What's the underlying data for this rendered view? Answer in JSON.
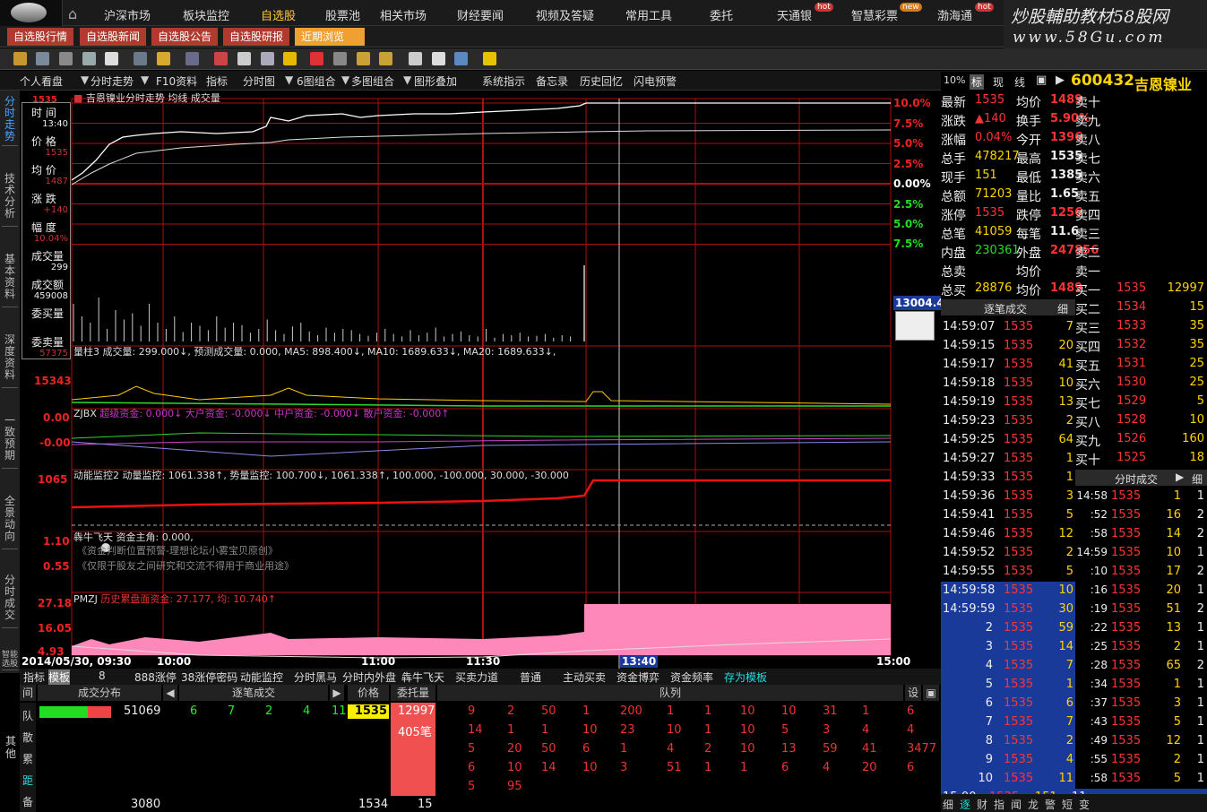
{
  "topnav": {
    "home_label": "⌂",
    "items": [
      {
        "label": "沪深市场",
        "hot": ""
      },
      {
        "label": "板块监控",
        "hot": ""
      },
      {
        "label": "自选股",
        "hot": ""
      },
      {
        "label": "股票池",
        "hot": ""
      },
      {
        "label": "相关市场",
        "hot": ""
      },
      {
        "label": "财经要闻",
        "hot": ""
      },
      {
        "label": "视频及答疑",
        "hot": ""
      },
      {
        "label": "常用工具",
        "hot": ""
      },
      {
        "label": "委托",
        "hot": ""
      },
      {
        "label": "天通银",
        "hot": "hot"
      },
      {
        "label": "智慧彩票",
        "hot": "new"
      },
      {
        "label": "渤海通",
        "hot": "hot"
      }
    ],
    "selected": "自选股"
  },
  "brand": {
    "line1": "炒股輔助教材58股网",
    "line2": "www.58Gu.com"
  },
  "subtabs": [
    "自选股行情",
    "自选股新闻",
    "自选股公告",
    "自选股研报",
    "近期浏览"
  ],
  "menubar": [
    "个人看盘",
    "分时走势",
    "F10资料",
    "指标",
    "分时图",
    "6图组合",
    "多图组合",
    "图形叠加",
    "系统指示",
    "备忘录",
    "历史回忆",
    "闪电预警"
  ],
  "lefttabs": [
    "分时走势",
    "技术分析",
    "基本资料",
    "深度资料",
    "一致预期",
    "全景动向",
    "分时成交",
    "智能选股"
  ],
  "chart": {
    "title": "吉恩镍业分时走势 均线 成交量",
    "left_top": "1535",
    "right_axis": [
      "10.0%",
      "7.5%",
      "5.0%",
      "2.5%",
      "0.00%",
      "2.5%",
      "5.0%",
      "7.5%"
    ],
    "crosshair_value": "13004.4",
    "crosshair_time": "13:40",
    "time_labels": [
      "2014/05/30, 09:30",
      "10:00",
      "11:00",
      "11:30",
      "13:40",
      "15:00"
    ]
  },
  "infobox": {
    "items": [
      {
        "label": "时 间",
        "value": "13:40"
      },
      {
        "label": "价 格",
        "value": "1535"
      },
      {
        "label": "均 价",
        "value": "1487"
      },
      {
        "label": "涨 跌",
        "value": "+140"
      },
      {
        "label": "幅 度",
        "value": "10.04%"
      },
      {
        "label": "成交量",
        "value": "299"
      },
      {
        "label": "成交额",
        "value": "459008"
      },
      {
        "label": "委买量",
        "value": ""
      },
      {
        "label": "委卖量",
        "value": "57375"
      }
    ]
  },
  "panels": {
    "vol": {
      "title": "量柱3 成交量: 299.000↓, 预测成交量: 0.000, MA5: 898.400↓, MA10: 1689.633↓, MA20: 1689.633↓,",
      "axis": "15343"
    },
    "zjbx": {
      "name": "ZJBX",
      "title": "超级资金: 0.000↓  大户资金: -0.000↓  中户资金: -0.000↓  散户资金: -0.000↑",
      "axis_top": "0.00",
      "axis_mid": "-0.00"
    },
    "dnjk": {
      "title": "动能监控2 动量监控: 1061.338↑, 势量监控: 100.700↓, 1061.338↑, 100.000, -100.000, 30.000, -30.000",
      "axis_top": "1065"
    },
    "qnft": {
      "title": "犇牛飞天 资金主角: 0.000,",
      "axis_top": "1.10",
      "axis_mid": "0.55",
      "note1": "《资金判断位置预警-理想论坛小雾宝贝原创》",
      "note2": "《仅限于股友之间研究和交流不得用于商业用途》"
    },
    "pmzj": {
      "name": "PMZJ",
      "title": "历史累盘面资金: 27.177,  均: 10.740↑",
      "axis_top": "27.18",
      "axis_mid": "16.05",
      "axis_low": "4.93"
    }
  },
  "bottomtabs": [
    "指标",
    "模板",
    "8",
    "888涨停",
    "38涨停密码",
    "动能监控",
    "分时黑马",
    "分时内外盘",
    "犇牛飞天",
    "买卖力道",
    "普通",
    "主动买卖",
    "资金博弈",
    "资金频率",
    "存为模板"
  ],
  "queue": {
    "headers": {
      "dist": "成交分布",
      "zbcj": "逐笔成交",
      "price": "价格",
      "wtl": "委托量",
      "queue": "队列",
      "set": "设"
    },
    "left_labels": [
      "队",
      "散",
      "累",
      "距",
      "备"
    ],
    "left_label2": "其他",
    "dist_value": "51069",
    "dist_bottom": "3080",
    "zbcj_row": [
      "6",
      "7",
      "2",
      "4",
      "11"
    ],
    "price_top": "1535",
    "price_bottom": "1534",
    "wtl_top": "12997",
    "wtl_count": "405笔",
    "wtl_bottom": "15",
    "rows": [
      [
        "9",
        "2",
        "50",
        "1",
        "200",
        "1",
        "1",
        "10",
        "10",
        "31",
        "1",
        "6"
      ],
      [
        "14",
        "1",
        "1",
        "10",
        "23",
        "10",
        "1",
        "10",
        "5",
        "3",
        "4",
        "4"
      ],
      [
        "5",
        "20",
        "50",
        "6",
        "1",
        "4",
        "2",
        "10",
        "13",
        "59",
        "41",
        "3477"
      ],
      [
        "6",
        "10",
        "14",
        "10",
        "3",
        "51",
        "1",
        "1",
        "6",
        "4",
        "20",
        "6"
      ],
      [
        "5",
        "95",
        "",
        "",
        "",
        "",
        "",
        "",
        "",
        "",
        "",
        ""
      ]
    ]
  },
  "right": {
    "header_tabs": [
      "10%",
      "标",
      "现",
      "线"
    ],
    "code": "600432",
    "name": "吉恩镍业",
    "stats": [
      [
        "最新",
        "1535",
        "均价",
        "1489"
      ],
      [
        "涨跌",
        "▲140",
        "换手",
        "5.90%"
      ],
      [
        "涨幅",
        "0.04%",
        "今开",
        "1396"
      ],
      [
        "总手",
        "478217",
        "最高",
        "1535"
      ],
      [
        "现手",
        "151",
        "最低",
        "1385"
      ],
      [
        "总额",
        "71203",
        "量比",
        "1.65"
      ],
      [
        "涨停",
        "1535",
        "跌停",
        "1256"
      ],
      [
        "总笔",
        "41059",
        "每笔",
        "11.6"
      ],
      [
        "内盘",
        "230361",
        "外盘",
        "247856"
      ],
      [
        "总卖",
        "",
        "均价",
        ""
      ],
      [
        "总买",
        "28876",
        "均价",
        "1489"
      ]
    ],
    "sell": [
      "卖十",
      "卖九",
      "卖八",
      "卖七",
      "卖六",
      "卖五",
      "卖四",
      "卖三",
      "卖二",
      "卖一"
    ],
    "buy": [
      [
        "买一",
        "1535",
        "12997"
      ],
      [
        "买二",
        "1534",
        "15"
      ],
      [
        "买三",
        "1533",
        "35"
      ],
      [
        "买四",
        "1532",
        "35"
      ],
      [
        "买五",
        "1531",
        "25"
      ],
      [
        "买六",
        "1530",
        "25"
      ],
      [
        "买七",
        "1529",
        "5"
      ],
      [
        "买八",
        "1528",
        "10"
      ],
      [
        "买九",
        "1526",
        "160"
      ],
      [
        "买十",
        "1525",
        "18"
      ]
    ],
    "zbcj_title": "逐笔成交",
    "zbcj_detail": "细",
    "zbcj": [
      [
        "14:59:07",
        "1535",
        "7"
      ],
      [
        "14:59:15",
        "1535",
        "20"
      ],
      [
        "14:59:17",
        "1535",
        "41"
      ],
      [
        "14:59:18",
        "1535",
        "10"
      ],
      [
        "14:59:19",
        "1535",
        "13"
      ],
      [
        "14:59:23",
        "1535",
        "2"
      ],
      [
        "14:59:25",
        "1535",
        "64"
      ],
      [
        "14:59:27",
        "1535",
        "1"
      ],
      [
        "14:59:33",
        "1535",
        "1"
      ],
      [
        "14:59:36",
        "1535",
        "3"
      ],
      [
        "14:59:41",
        "1535",
        "5"
      ],
      [
        "14:59:46",
        "1535",
        "12"
      ],
      [
        "14:59:52",
        "1535",
        "2"
      ],
      [
        "14:59:55",
        "1535",
        "5"
      ],
      [
        "14:59:58",
        "1535",
        "10"
      ],
      [
        "14:59:59",
        "1535",
        "30"
      ]
    ],
    "zbcj_blue": [
      [
        "2",
        "1535",
        "59"
      ],
      [
        "3",
        "1535",
        "14"
      ],
      [
        "4",
        "1535",
        "7"
      ],
      [
        "5",
        "1535",
        "1"
      ],
      [
        "6",
        "1535",
        "6"
      ],
      [
        "7",
        "1535",
        "7"
      ],
      [
        "8",
        "1535",
        "2"
      ],
      [
        "9",
        "1535",
        "4"
      ],
      [
        "10",
        "1535",
        "11"
      ]
    ],
    "fscj_title": "分时成交",
    "fscj": [
      [
        "14:58",
        "1535",
        "1",
        "1"
      ],
      [
        ":52",
        "1535",
        "16",
        "2"
      ],
      [
        ":58",
        "1535",
        "14",
        "2"
      ],
      [
        "14:59",
        "1535",
        "10",
        "1"
      ],
      [
        ":10",
        "1535",
        "17",
        "2"
      ],
      [
        ":16",
        "1535",
        "20",
        "1"
      ],
      [
        ":19",
        "1535",
        "51",
        "2"
      ],
      [
        ":22",
        "1535",
        "13",
        "1"
      ],
      [
        ":25",
        "1535",
        "2",
        "1"
      ],
      [
        ":28",
        "1535",
        "65",
        "2"
      ],
      [
        ":34",
        "1535",
        "1",
        "1"
      ],
      [
        ":37",
        "1535",
        "3",
        "1"
      ],
      [
        ":43",
        "1535",
        "5",
        "1"
      ],
      [
        ":49",
        "1535",
        "12",
        "1"
      ],
      [
        ":55",
        "1535",
        "2",
        "1"
      ],
      [
        ":58",
        "1535",
        "5",
        "1"
      ]
    ],
    "last_row": [
      "15:00",
      "1535",
      "151",
      "11"
    ],
    "bottom_tabs": [
      "细",
      "逐",
      "财",
      "指",
      "闻",
      "龙",
      "警",
      "短",
      "变"
    ]
  }
}
